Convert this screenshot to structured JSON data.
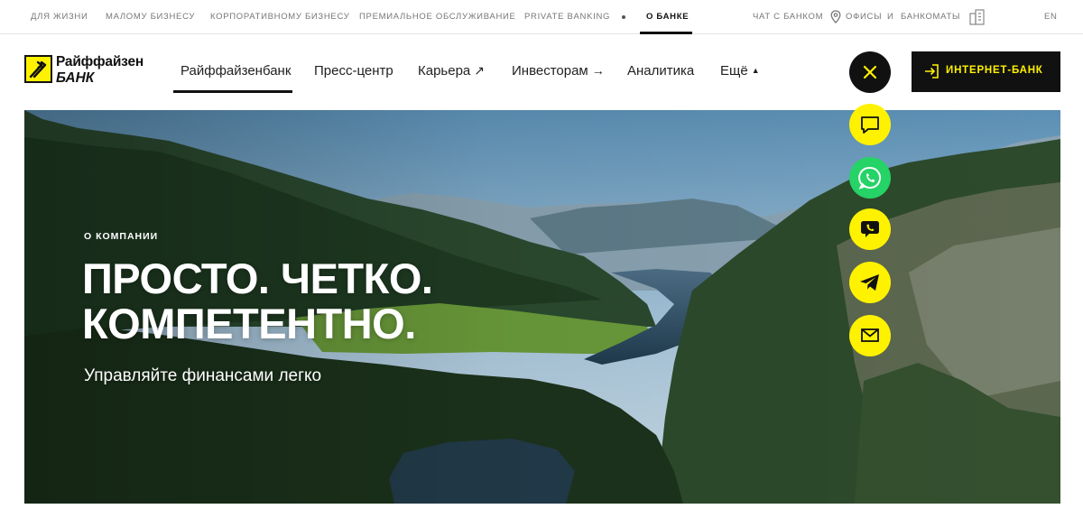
{
  "topbar": {
    "segments": [
      "Для жизни",
      "Малому бизнесу",
      "Корпоративному бизнесу",
      "Премиальное обслуживание",
      "Private Banking",
      "О банке"
    ],
    "chat": "Чат с банком",
    "offices": "Офисы",
    "and": "и",
    "atms": "Банкоматы",
    "lang": "EN"
  },
  "logo": {
    "name": "Райффайзен",
    "bank": "БАНК"
  },
  "nav": {
    "items": [
      "Райффайзенбанк",
      "Пресс-центр",
      "Карьера",
      "Инвесторам",
      "Аналитика",
      "Ещё"
    ]
  },
  "internet_bank": {
    "label": "ИНТЕРНЕТ-БАНК"
  },
  "hero": {
    "kicker": "О КОМПАНИИ",
    "title_line1": "ПРОСТО. ЧЕТКО.",
    "title_line2": "КОМПЕТЕНТНО.",
    "subtitle": "Управляйте финансами легко"
  },
  "contacts": [
    "chat-icon",
    "whatsapp-icon",
    "viber-icon",
    "telegram-icon",
    "mail-icon"
  ],
  "colors": {
    "brand_yellow": "#fff200",
    "whatsapp_green": "#25d366",
    "dark": "#111111"
  }
}
